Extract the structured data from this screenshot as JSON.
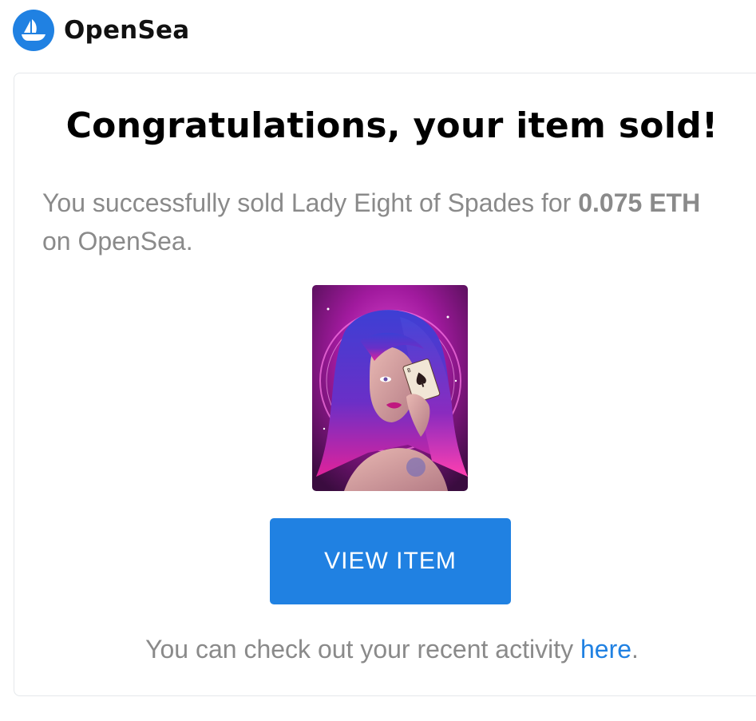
{
  "brand": {
    "name": "OpenSea",
    "logo_icon": "opensea-ship-icon",
    "accent_color": "#2081E2"
  },
  "email": {
    "headline": "Congratulations, your item sold!",
    "message_prefix": "You successfully sold Lady Eight of Spades for ",
    "price": "0.075 ETH",
    "message_suffix": " on OpenSea.",
    "item_image_icon": "nft-artwork-lady-eight-of-spades",
    "view_button_label": "VIEW ITEM",
    "footer_prefix": "You can check out your recent activity ",
    "footer_link_label": "here",
    "footer_suffix": "."
  }
}
